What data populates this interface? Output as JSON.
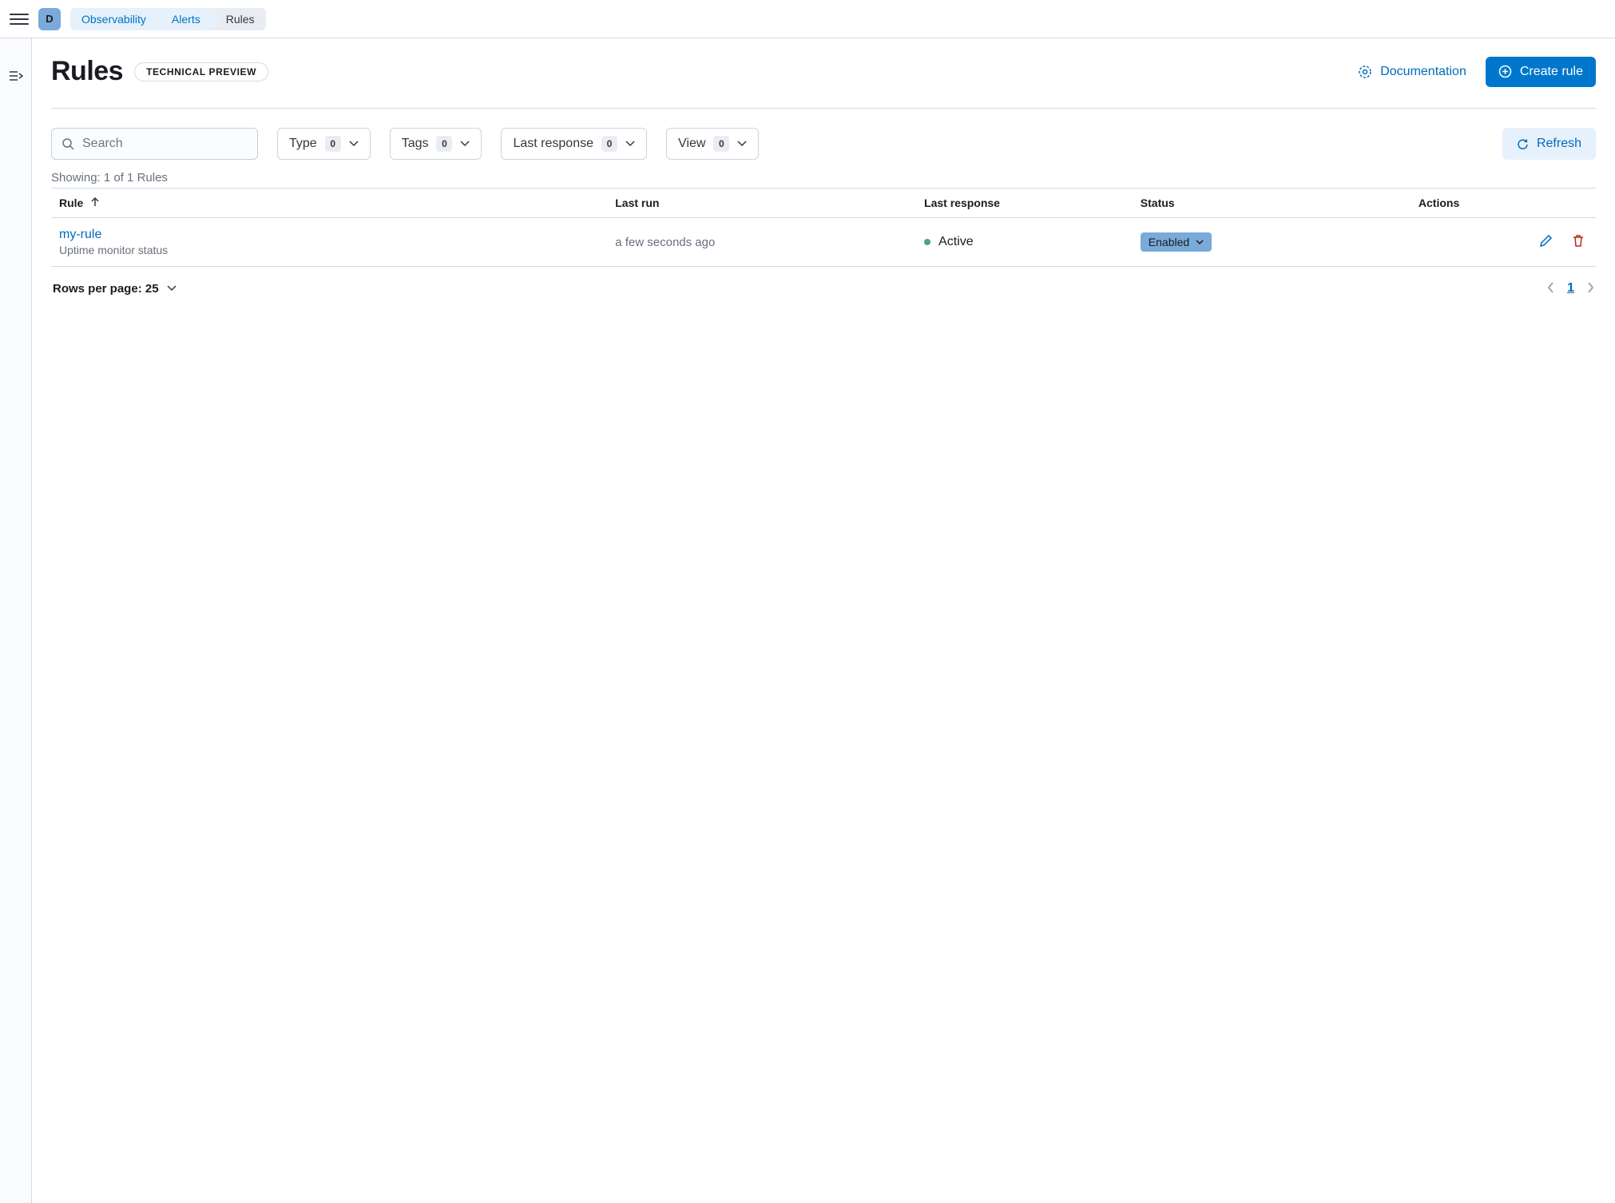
{
  "topbar": {
    "avatar_letter": "D",
    "breadcrumbs": [
      {
        "label": "Observability",
        "link": true
      },
      {
        "label": "Alerts",
        "link": true
      },
      {
        "label": "Rules",
        "link": false
      }
    ]
  },
  "header": {
    "title": "Rules",
    "badge": "TECHNICAL PREVIEW",
    "documentation_label": "Documentation",
    "create_rule_label": "Create rule"
  },
  "filters": {
    "search_placeholder": "Search",
    "type": {
      "label": "Type",
      "count": "0"
    },
    "tags": {
      "label": "Tags",
      "count": "0"
    },
    "last_response": {
      "label": "Last response",
      "count": "0"
    },
    "view": {
      "label": "View",
      "count": "0"
    },
    "refresh_label": "Refresh"
  },
  "showing_text": "Showing: 1 of 1 Rules",
  "table": {
    "columns": {
      "rule": "Rule",
      "last_run": "Last run",
      "last_response": "Last response",
      "status": "Status",
      "actions": "Actions"
    },
    "rows": [
      {
        "name": "my-rule",
        "subtitle": "Uptime monitor status",
        "last_run": "a few seconds ago",
        "last_response": "Active",
        "status": "Enabled"
      }
    ]
  },
  "footer": {
    "rows_per_page_label": "Rows per page: 25",
    "current_page": "1"
  },
  "colors": {
    "primary": "#0077cc",
    "link": "#006bb8",
    "danger": "#bd271e",
    "success_dot": "#4da28f"
  }
}
